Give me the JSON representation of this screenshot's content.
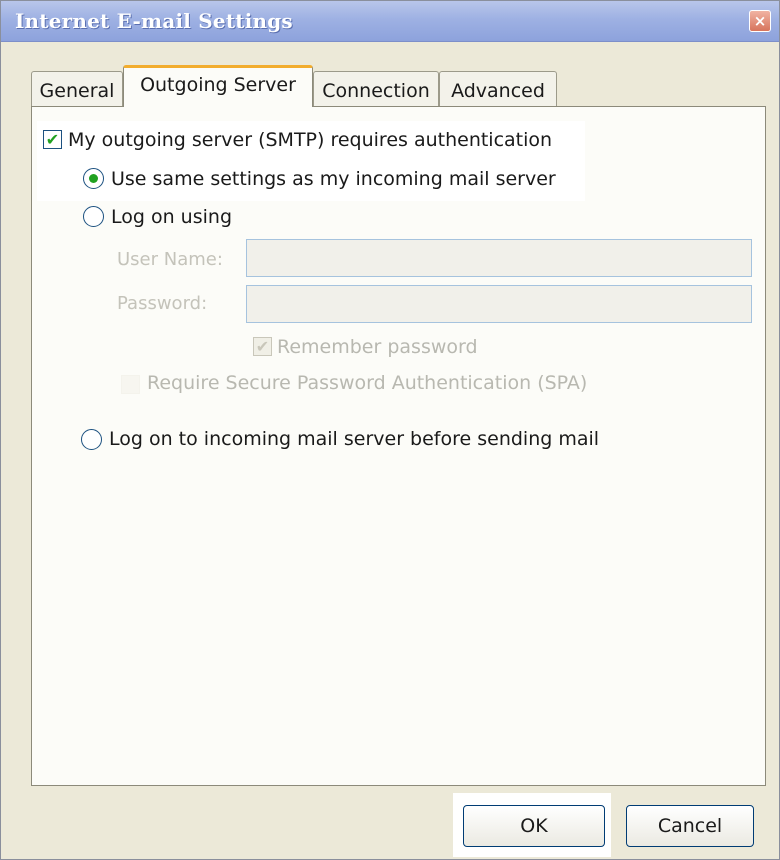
{
  "window": {
    "title": "Internet E-mail Settings",
    "close_glyph": "×"
  },
  "tabs": [
    {
      "label": "General"
    },
    {
      "label": "Outgoing Server"
    },
    {
      "label": "Connection"
    },
    {
      "label": "Advanced"
    }
  ],
  "auth": {
    "requires_auth_label": "My outgoing server (SMTP) requires authentication",
    "requires_auth_checked": true,
    "same_settings_label": "Use same settings as my incoming mail server",
    "log_on_using_label": "Log on using",
    "user_name_label": "User Name:",
    "user_name_value": "",
    "password_label": "Password:",
    "password_value": "",
    "remember_password_label": "Remember password",
    "spa_label": "Require Secure Password Authentication (SPA)",
    "log_on_incoming_label": "Log on to incoming mail server before sending mail",
    "selected_option": "same_settings"
  },
  "buttons": {
    "ok": "OK",
    "cancel": "Cancel"
  },
  "colors": {
    "titlebar": "#9eb1e3",
    "dialog_bg": "#ece9d8",
    "active_tab_accent": "#f2ad2e",
    "check_green": "#21a121",
    "control_border": "#1c5180"
  },
  "icons": {
    "checkmark": "✔",
    "close": "close-icon"
  }
}
